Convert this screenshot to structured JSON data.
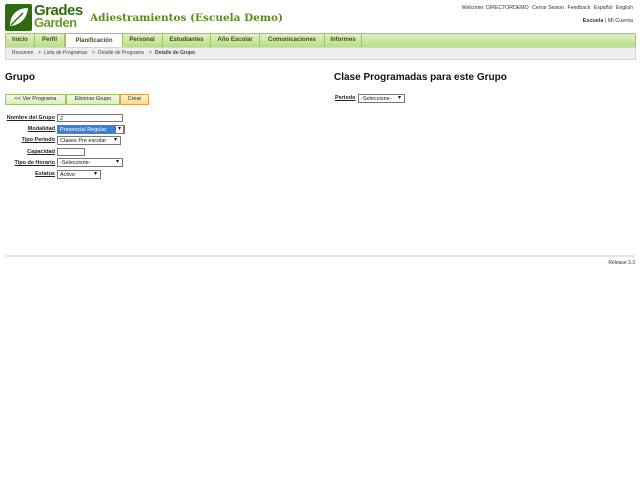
{
  "header": {
    "logo_top": "Grades",
    "logo_bottom": "Garden",
    "site_title": "Adiestramientos (Escuela Demo)",
    "welcome": "Welcome: DIRECTORDEMO",
    "links": [
      "Cerrar Sesion",
      "Feedback",
      "Español",
      "English"
    ],
    "school_label": "Escuela",
    "school_sep": "|",
    "school_link": "Mi Cuenta"
  },
  "nav": {
    "items": [
      "Inicio",
      "Perfil",
      "Planificación",
      "Personal",
      "Estudiantes",
      "Año Escolar",
      "Comunicaciones",
      "Informes"
    ],
    "active": "Planificación"
  },
  "breadcrumb": {
    "items": [
      "Resumen",
      "Lista de Programas",
      "Detalle de Programa",
      "Detalle de Grupo"
    ],
    "separator": ">"
  },
  "group": {
    "title": "Grupo",
    "buttons": {
      "back": "<< Ver Programa",
      "delete": "Eliminar Grupo",
      "create": "Crear"
    },
    "form": {
      "nombre": {
        "label": "Nombre del Grupo",
        "value": "2"
      },
      "modalidad": {
        "label": "Modalidad",
        "value": "Presencial Regular"
      },
      "tipo_periodo": {
        "label": "Tipo Periodo",
        "value": "Clases Pre escolar"
      },
      "capacidad": {
        "label": "Capacidad",
        "value": ""
      },
      "tipo_horario": {
        "label": "Tipo de Horario",
        "value": "-Seleccione-"
      },
      "estatus": {
        "label": "Estatus",
        "value": "Activo"
      }
    }
  },
  "classes": {
    "title": "Clase Programadas para este Grupo",
    "periodo_label": "Periodo",
    "periodo_value": "-Seleccione-"
  },
  "footer": {
    "release": "Release 3.3"
  },
  "colors": {
    "brand_green": "#2f6b12",
    "title_green": "#5c8a1c",
    "nav_border": "#9cc56a",
    "highlight_blue": "#3b7fd8",
    "create_orange": "#ffd990"
  }
}
